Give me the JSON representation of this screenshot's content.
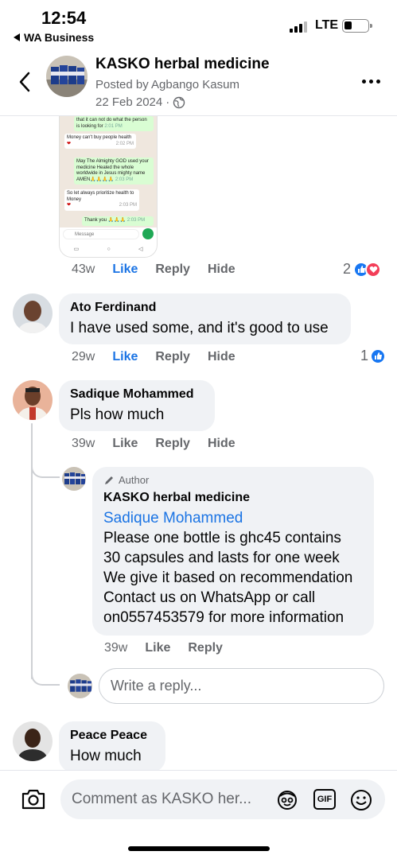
{
  "status_bar": {
    "time": "12:54",
    "back_app": "WA Business",
    "network": "LTE"
  },
  "header": {
    "title": "KASKO herbal medicine",
    "posted_by": "Posted by Agbango Kasum",
    "date": "22 Feb 2024",
    "audience_icon": "globe-icon"
  },
  "embedded_image": {
    "messages": [
      {
        "dir": "out",
        "text": "that it can not do what the person is looking for",
        "time": "2:01 PM"
      },
      {
        "dir": "in",
        "text": "Money can't buy people health",
        "time": "2:02 PM"
      },
      {
        "dir": "out",
        "text": "May The Almighty GOD used your medicine Healed the whole worldwide in Jesus mighty name AMEN🙏🙏🙏🙏",
        "time": "2:03 PM"
      },
      {
        "dir": "in",
        "text": "So let always prioritize health to Money",
        "time": "2:03 PM"
      },
      {
        "dir": "out",
        "text": "Thank you 🙏🙏🙏",
        "time": "2:03 PM"
      }
    ],
    "input_placeholder": "Message"
  },
  "post_meta": {
    "time": "43w",
    "like": "Like",
    "reply": "Reply",
    "hide": "Hide",
    "reaction_count": "2"
  },
  "comments": [
    {
      "name": "Ato Ferdinand",
      "text": "I have used some, and it's good to use",
      "time": "29w",
      "like": "Like",
      "reply": "Reply",
      "hide": "Hide",
      "reaction_count": "1"
    },
    {
      "name": "Sadique Mohammed",
      "text": "Pls how much",
      "time": "39w",
      "like": "Like",
      "reply": "Reply",
      "hide": "Hide"
    },
    {
      "name": "Peace Peace",
      "text": "How much"
    }
  ],
  "author_reply": {
    "badge": "Author",
    "name": "KASKO herbal medicine",
    "mention": "Sadique Mohammed",
    "lines": [
      "Please one bottle is ghc45 contains",
      "30 capsules and lasts for one week",
      "We give it based on recommendation",
      "Contact us on WhatsApp or call",
      "on0557453579 for more information"
    ],
    "time": "39w",
    "like": "Like",
    "reply": "Reply"
  },
  "reply_input": {
    "placeholder": "Write a reply..."
  },
  "comment_bar": {
    "placeholder": "Comment as KASKO her...",
    "gif": "GIF"
  },
  "colors": {
    "link_blue": "#1b74e4",
    "like_blue": "#1877f2",
    "love_red": "#f33e58",
    "bubble_gray": "#f0f2f5"
  }
}
